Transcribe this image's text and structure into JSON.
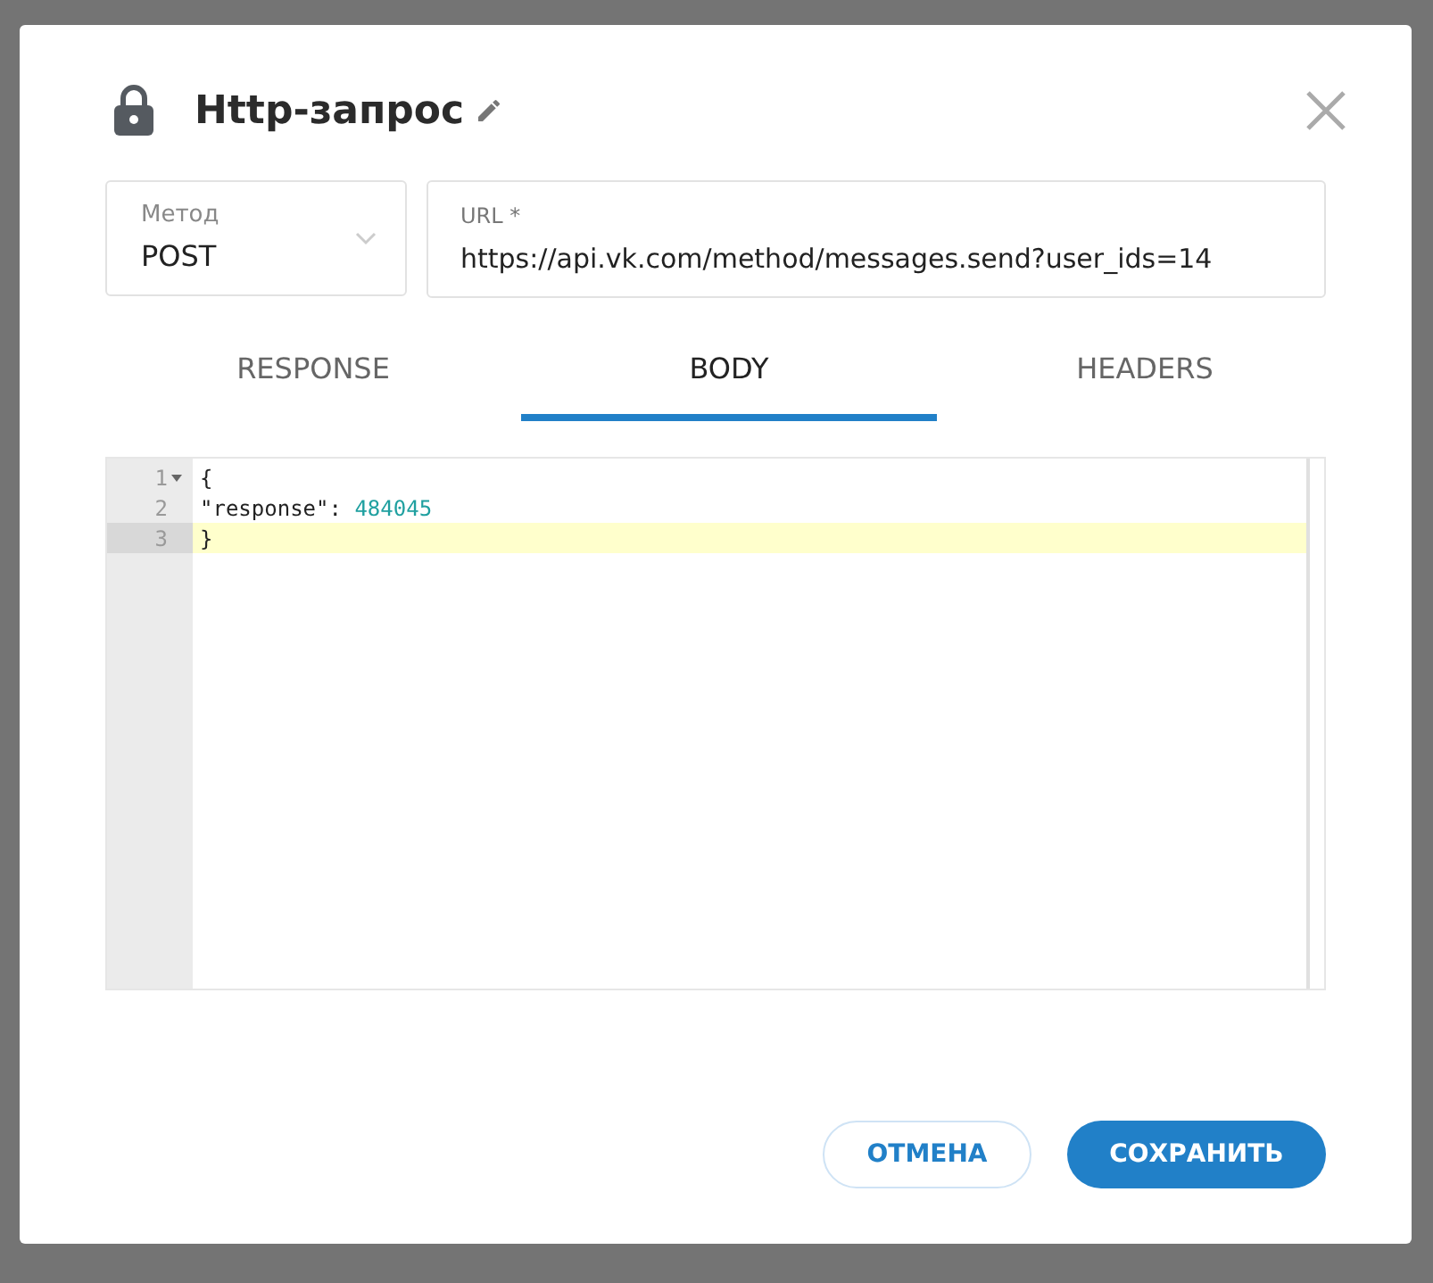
{
  "dialog": {
    "title": "Http-запрос"
  },
  "method": {
    "label": "Метод",
    "value": "POST"
  },
  "url": {
    "label": "URL *",
    "value": "https://api.vk.com/method/messages.send?user_ids=14"
  },
  "tabs": [
    {
      "label": "RESPONSE",
      "selected": false
    },
    {
      "label": "BODY",
      "selected": true
    },
    {
      "label": "HEADERS",
      "selected": false
    }
  ],
  "editor": {
    "lines": [
      {
        "number": "1",
        "foldable": true,
        "active": false,
        "tokens": [
          {
            "kind": "plain",
            "text": "{"
          }
        ]
      },
      {
        "number": "2",
        "foldable": false,
        "active": false,
        "tokens": [
          {
            "kind": "plain",
            "text": "\"response\": "
          },
          {
            "kind": "number",
            "text": "484045"
          }
        ]
      },
      {
        "number": "3",
        "foldable": false,
        "active": true,
        "tokens": [
          {
            "kind": "plain",
            "text": "}"
          }
        ]
      }
    ]
  },
  "buttons": [
    {
      "kind": "secondary",
      "label": "ОТМЕНА"
    },
    {
      "kind": "primary",
      "label": "СОХРАНИТЬ"
    }
  ]
}
